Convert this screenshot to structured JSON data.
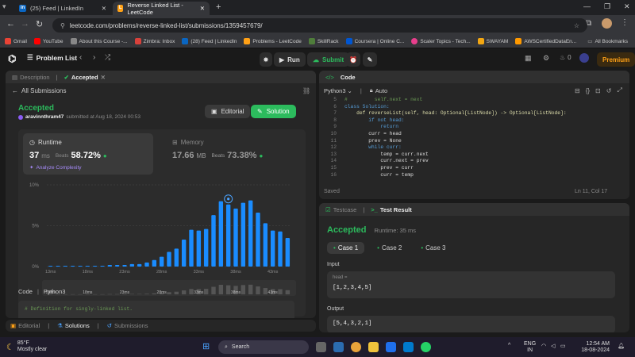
{
  "browser": {
    "tabs": [
      {
        "icon": "in",
        "title": "(25) Feed | LinkedIn"
      },
      {
        "icon": "lc",
        "title": "Reverse Linked List - LeetCode"
      }
    ],
    "url": "leetcode.com/problems/reverse-linked-list/submissions/1359457679/",
    "bookmarks": [
      "Gmail",
      "YouTube",
      "About this Course -...",
      "Zimbra: Inbox",
      "(28) Feed | LinkedIn",
      "Problems - LeetCode",
      "SkillRack",
      "Coursera | Online C...",
      "Scaler Topics - Tech...",
      "SWAYAM",
      "AWSCertifiedDataEn..."
    ],
    "all_bookmarks": "All Bookmarks"
  },
  "header": {
    "problem_list": "Problem List",
    "run": "Run",
    "submit": "Submit",
    "streak": "0",
    "premium": "Premium"
  },
  "left": {
    "tabs": {
      "description": "Description",
      "accepted": "Accepted",
      "editorial": "Editorial",
      "solutions": "Solutions",
      "submissions": "Submissions"
    },
    "all_submissions": "All Submissions",
    "status": "Accepted",
    "user": "aravinnthram47",
    "submitted": "submitted at Aug 18, 2024 00:53",
    "editorial_btn": "Editorial",
    "solution_btn": "Solution",
    "runtime_label": "Runtime",
    "runtime_value": "37",
    "runtime_unit": "ms",
    "beats": "Beats",
    "runtime_beats": "58.72%",
    "analyze": "Analyze Complexity",
    "memory_label": "Memory",
    "memory_value": "17.66",
    "memory_unit": "MB",
    "memory_beats": "73.38%",
    "code_label": "Code",
    "code_lang": "Python3",
    "code_first": "# Definition for singly-linked list."
  },
  "chart_data": {
    "type": "bar",
    "title": "",
    "xlabel": "",
    "ylabel": "",
    "yticks": [
      "10%",
      "5%",
      "0%"
    ],
    "ylim": [
      0,
      10
    ],
    "xticks": [
      "13ms",
      "18ms",
      "23ms",
      "28ms",
      "33ms",
      "38ms",
      "43ms"
    ],
    "minimap_xticks": [
      "13ms",
      "18ms",
      "23ms",
      "28ms",
      "33ms",
      "38ms",
      "43ms"
    ],
    "categories_ms": [
      13,
      14,
      15,
      16,
      17,
      18,
      19,
      20,
      21,
      22,
      23,
      24,
      25,
      26,
      27,
      28,
      29,
      30,
      31,
      32,
      33,
      34,
      35,
      36,
      37,
      38,
      39,
      40,
      41,
      42,
      43,
      44,
      45
    ],
    "values": [
      0.1,
      0.1,
      0.1,
      0.1,
      0.1,
      0.1,
      0.1,
      0.1,
      0.2,
      0.2,
      0.2,
      0.3,
      0.3,
      0.5,
      0.8,
      1.2,
      1.8,
      2.2,
      3.3,
      4.5,
      4.4,
      4.6,
      6.3,
      8.0,
      7.6,
      7.1,
      7.8,
      8.1,
      6.6,
      5.3,
      4.4,
      4.3,
      3.5
    ],
    "highlight": "37ms",
    "color": "#1a8cff"
  },
  "code_panel": {
    "title": "Code",
    "lang": "Python3",
    "auto": "Auto",
    "saved": "Saved",
    "cursor": "Ln 11, Col 17",
    "lines": [
      {
        "n": "5",
        "text": "#         self.next = next",
        "cls": "c"
      },
      {
        "n": "6",
        "text": "class Solution:",
        "cls": "k"
      },
      {
        "n": "7",
        "text": "    def reverseList(self, head: Optional[ListNode]) -> Optional[ListNode]:",
        "cls": "f"
      },
      {
        "n": "8",
        "text": "        if not head:",
        "cls": "k"
      },
      {
        "n": "9",
        "text": "            return",
        "cls": "k"
      },
      {
        "n": "10",
        "text": "        curr = head",
        "cls": "s"
      },
      {
        "n": "11",
        "text": "        prev = None",
        "cls": "s"
      },
      {
        "n": "12",
        "text": "        while curr:",
        "cls": "k"
      },
      {
        "n": "13",
        "text": "            temp = curr.next",
        "cls": "s"
      },
      {
        "n": "14",
        "text": "            curr.next = prev",
        "cls": "s"
      },
      {
        "n": "15",
        "text": "            prev = curr",
        "cls": "s"
      },
      {
        "n": "16",
        "text": "            curr = temp",
        "cls": "s"
      }
    ]
  },
  "result_panel": {
    "testcase": "Testcase",
    "test_result": "Test Result",
    "status": "Accepted",
    "runtime": "Runtime: 35 ms",
    "cases": [
      "Case 1",
      "Case 2",
      "Case 3"
    ],
    "input_label": "Input",
    "param": "head =",
    "input_value": "[1,2,3,4,5]",
    "output_label": "Output",
    "output_value": "[5,4,3,2,1]"
  },
  "taskbar": {
    "temp": "85°F",
    "weather": "Mostly clear",
    "search": "Search",
    "lang1": "ENG",
    "lang2": "IN",
    "time": "12:54 AM",
    "date": "18-08-2024"
  }
}
